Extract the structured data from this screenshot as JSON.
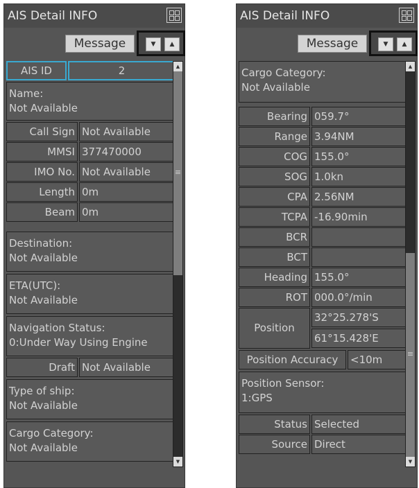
{
  "left": {
    "title": "AIS Detail INFO",
    "message_label": "Message",
    "aisid_label": "AIS ID",
    "aisid_value": "2",
    "name_label": "Name:",
    "name_value": "Not Available",
    "rows": [
      {
        "label": "Call Sign",
        "value": "Not Available"
      },
      {
        "label": "MMSI",
        "value": "377470000"
      },
      {
        "label": "IMO No.",
        "value": "Not Available"
      },
      {
        "label": "Length",
        "value": "0m"
      },
      {
        "label": "Beam",
        "value": "0m"
      }
    ],
    "destination_label": "Destination:",
    "destination_value": "Not Available",
    "eta_label": "ETA(UTC):",
    "eta_value": "Not Available",
    "navstatus_label": "Navigation Status:",
    "navstatus_value": "0:Under Way Using Engine",
    "draft_label": "Draft",
    "draft_value": "Not Available",
    "shiptype_label": "Type of ship:",
    "shiptype_value": "Not Available",
    "cargo_label": "Cargo Category:",
    "cargo_value": "Not Available"
  },
  "right": {
    "title": "AIS Detail INFO",
    "message_label": "Message",
    "cargo_label": "Cargo Category:",
    "cargo_value": "Not Available",
    "rows": [
      {
        "label": "Bearing",
        "value": "059.7°"
      },
      {
        "label": "Range",
        "value": "3.94NM"
      },
      {
        "label": "COG",
        "value": "155.0°"
      },
      {
        "label": "SOG",
        "value": "1.0kn"
      },
      {
        "label": "CPA",
        "value": "2.56NM"
      },
      {
        "label": "TCPA",
        "value": "-16.90min"
      },
      {
        "label": "BCR",
        "value": ""
      },
      {
        "label": "BCT",
        "value": ""
      },
      {
        "label": "Heading",
        "value": "155.0°"
      },
      {
        "label": "ROT",
        "value": "000.0°/min"
      }
    ],
    "position_label": "Position",
    "position_lat": "32°25.278'S",
    "position_lon": "61°15.428'E",
    "posacc_label": "Position Accuracy",
    "posacc_value": "<10m",
    "sensor_label": "Position Sensor:",
    "sensor_value": "1:GPS",
    "status_label": "Status",
    "status_value": "Selected",
    "source_label": "Source",
    "source_value": "Direct"
  },
  "icons": {
    "window_icon": "grid-icon",
    "arrow_down": "triangle-down-icon",
    "arrow_up": "triangle-up-icon",
    "scroll_grip": "grip-icon"
  },
  "colors": {
    "panel_bg": "#555555",
    "highlight_border": "#39a9d0"
  }
}
